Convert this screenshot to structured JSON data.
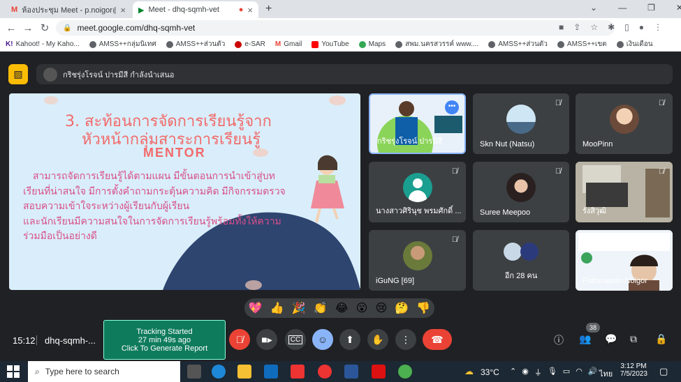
{
  "browser": {
    "tabs": [
      {
        "title": "ห้องประชุม Meet - p.noigor@gmai",
        "close": "×"
      },
      {
        "title": "Meet - dhq-sqmh-vet",
        "close": "×"
      }
    ],
    "new_tab": "+",
    "url": "meet.google.com/dhq-sqmh-vet",
    "bookmarks": [
      "Kahoot! - My Kaho...",
      "AMSS++กลุ่มนิเทศ",
      "AMSS++ส่วนตัว",
      "e-SAR",
      "Gmail",
      "YouTube",
      "Maps",
      "สพม.นครสวรรค์ www....",
      "AMSS++ส่วนตัว",
      "AMSS++เขต",
      "เงินเดือน"
    ]
  },
  "presenter_bar": {
    "text": "กริชรุ่งโรจน์ ปารมีสี กำลังนำเสนอ"
  },
  "slide": {
    "title_line1": "3. สะท้อนการจัดการเรียนรู้จาก",
    "title_line2": "หัวหน้ากลุ่มสาระการเรียนรู้",
    "subtitle": "MENTOR",
    "body": [
      "สามารถจัดการเรียนรู้ได้ตามแผน มีขั้นตอนการนำเข้าสู่บท",
      "เรียนที่น่าสนใจ มีการตั้งคำถามกระตุ้นความคิด มีกิจกรรมตรวจ",
      "สอบความเข้าใจระหว่างผู้เรียนกับผู้เรียน",
      "และนักเรียนมีความสนใจในการจัดการเรียนรู้พร้อมทั้งให้ความ",
      "ร่วมมือเป็นอย่างดี"
    ]
  },
  "participants": [
    {
      "name": "กริชรุ่งโรจน์ ปารมีสี"
    },
    {
      "name": "Skn Nut (Natsu)"
    },
    {
      "name": "MooPinn"
    },
    {
      "name": "นางสาวศิรินุช พรมศักดิ์ ..."
    },
    {
      "name": "Suree Meepoo"
    },
    {
      "name": "รังสิวุฒิ"
    },
    {
      "name": "iGuNG [69]"
    },
    {
      "name": "อีก 28 คน"
    },
    {
      "name": "Pattaraporn Noigor"
    }
  ],
  "reactions": [
    "💖",
    "👍",
    "🎉",
    "👏",
    "😂",
    "😮",
    "😢",
    "🤔",
    "👎"
  ],
  "meeting": {
    "time": "15:12",
    "code": "dhq-sqmh-...",
    "people_count": "38"
  },
  "tracking": {
    "line1": "Tracking Started",
    "line2": "27 min 49s ago",
    "line3": "Click To Generate Report"
  },
  "taskbar": {
    "search": "Type here to search",
    "weather": "33°C",
    "lang": "ไทย",
    "time": "3:12 PM",
    "date": "7/5/2023"
  },
  "colors": {
    "meet_bg": "#202124",
    "tile_bg": "#3c4043",
    "end_call": "#ea4335",
    "accent": "#8ab4f8",
    "slide_bg": "#d9eefa",
    "slide_title": "#f26a6a",
    "slide_text": "#d94f8a"
  }
}
